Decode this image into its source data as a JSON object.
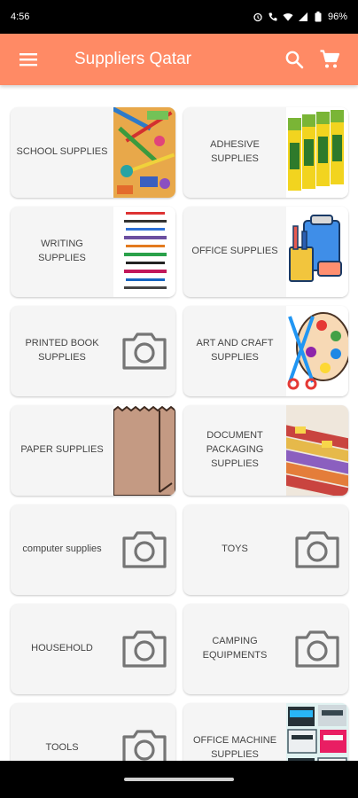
{
  "status": {
    "time": "4:56",
    "battery": "96%"
  },
  "app_bar": {
    "title": "Suppliers Qatar",
    "menu_icon": "menu-icon",
    "search_icon": "search-icon",
    "cart_icon": "cart-icon"
  },
  "colors": {
    "accent": "#ff8a65",
    "card_bg": "#f5f5f5",
    "label": "#444444"
  },
  "categories": [
    {
      "label": "SCHOOL SUPPLIES",
      "image": "school-supplies-photo"
    },
    {
      "label": "ADHESIVE SUPPLIES",
      "image": "glue-sticks-photo"
    },
    {
      "label": "WRITING SUPPLIES",
      "image": "pens-photo"
    },
    {
      "label": "OFFICE SUPPLIES",
      "image": "office-supplies-illustration"
    },
    {
      "label": "PRINTED BOOK SUPPLIES",
      "image": "camera-placeholder-icon"
    },
    {
      "label": "ART AND CRAFT SUPPLIES",
      "image": "art-palette-illustration"
    },
    {
      "label": "PAPER SUPPLIES",
      "image": "paper-bag-illustration"
    },
    {
      "label": "DOCUMENT PACKAGING SUPPLIES",
      "image": "document-files-photo"
    },
    {
      "label": "computer supplies",
      "image": "camera-placeholder-icon"
    },
    {
      "label": "TOYS",
      "image": "camera-placeholder-icon"
    },
    {
      "label": "HOUSEHOLD",
      "image": "camera-placeholder-icon"
    },
    {
      "label": "CAMPING EQUIPMENTS",
      "image": "camera-placeholder-icon"
    },
    {
      "label": "TOOLS",
      "image": "camera-placeholder-icon"
    },
    {
      "label": "OFFICE MACHINE SUPPLIES",
      "image": "office-machines-photo"
    }
  ]
}
